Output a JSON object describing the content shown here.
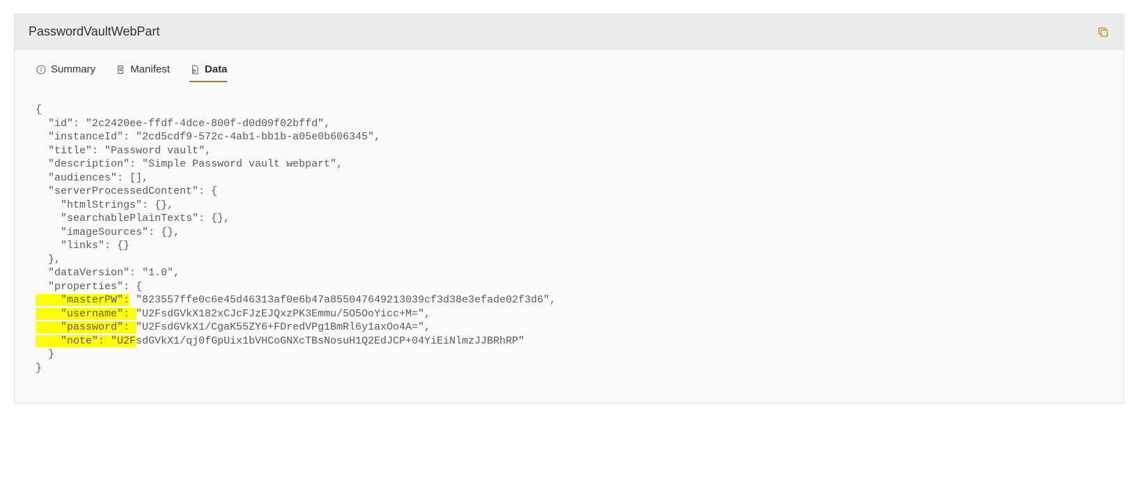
{
  "header": {
    "title": "PasswordVaultWebPart"
  },
  "tabs": {
    "summary": "Summary",
    "manifest": "Manifest",
    "data": "Data"
  },
  "code": {
    "line1": "{",
    "line2a": "  \"id\": \"",
    "line2b": "2c2420ee-ffdf-4dce-800f-d0d09f02bffd",
    "line2c": "\",",
    "line3a": "  \"instanceId\": \"",
    "line3b": "2cd5cdf9-572c-4ab1-bb1b-a05e0b606345",
    "line3c": "\",",
    "line4a": "  \"title\": \"",
    "line4b": "Password vault",
    "line4c": "\",",
    "line5a": "  \"description\": \"",
    "line5b": "Simple Password vault webpart",
    "line5c": "\",",
    "line6": "  \"audiences\": [],",
    "line7": "  \"serverProcessedContent\": {",
    "line8": "    \"htmlStrings\": {},",
    "line9": "    \"searchablePlainTexts\": {},",
    "line10": "    \"imageSources\": {},",
    "line11": "    \"links\": {}",
    "line12": "  },",
    "line13a": "  \"dataVersion\": \"",
    "line13b": "1.0",
    "line13c": "\",",
    "line14": "  \"properties\": {",
    "hl_masterPW_key": "    \"masterPW\":",
    "masterPW_val": " \"823557ffe0c6e45d46313af0e6b47a855047649213039cf3d38e3efade02f3d6\",",
    "hl_username_key": "    \"username\": ",
    "username_val": "\"U2FsdGVkX182xCJcFJzEJQxzPK3Emmu/5O5OoYicc+M=\",",
    "hl_password_key": "    \"password\": ",
    "password_val": "\"U2FsdGVkX1/CgaK55ZY6+FDredVPg1BmRl6y1axOo4A=\",",
    "hl_note_key": "    \"note\": ",
    "note_val_hl": "\"U2F",
    "note_val_rest": "sdGVkX1/qj0fGpUix1bVHCoGNXcTBsNosuH1Q2EdJCP+04YiEiNlmzJJBRhRP\"",
    "line19": "  }",
    "line20": "}"
  }
}
